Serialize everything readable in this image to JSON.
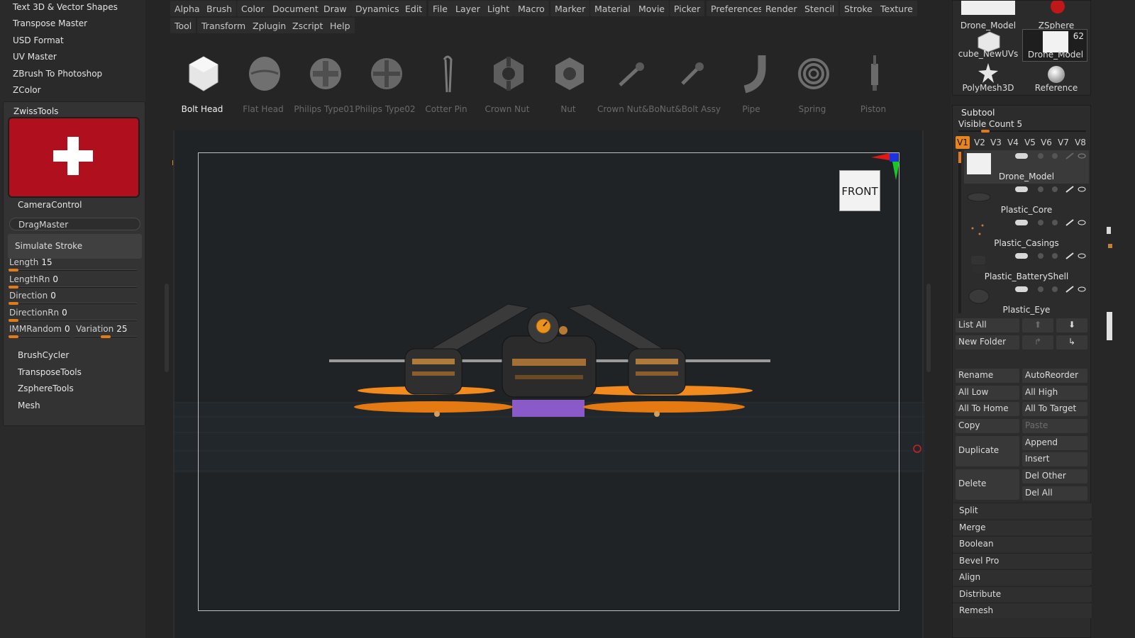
{
  "left_panel": {
    "plugins_top": [
      "Text 3D & Vector Shapes",
      "Transpose Master",
      "USD Format",
      "UV Master",
      "ZBrush To Photoshop",
      "ZColor"
    ],
    "zwiss": {
      "title": "ZwissTools",
      "logo": "swiss-cross-logo",
      "camera_control": "CameraControl",
      "drag_master": "DragMaster",
      "simulate_stroke": "Simulate Stroke",
      "sliders": [
        {
          "label": "Length",
          "value": "15"
        },
        {
          "label": "LengthRn",
          "value": "0"
        },
        {
          "label": "Direction",
          "value": "0"
        },
        {
          "label": "DirectionRn",
          "value": "0"
        }
      ],
      "imm_random": {
        "label": "IMMRandom",
        "value": "0"
      },
      "variation": {
        "label": "Variation",
        "value": "25"
      },
      "bottom_items": [
        "BrushCycler",
        "TransposeTools",
        "ZsphereTools",
        "Mesh"
      ]
    }
  },
  "menus": {
    "row1": [
      "Alpha",
      "Brush",
      "Color",
      "Document",
      "Draw",
      "Dynamics",
      "Edit",
      "File",
      "Layer",
      "Light",
      "Macro",
      "Marker",
      "Material",
      "Movie",
      "Picker",
      "Preferences",
      "Render",
      "Stencil",
      "Stroke",
      "Texture"
    ],
    "row2": [
      "Tool",
      "Transform",
      "Zplugin",
      "Zscript",
      "Help"
    ]
  },
  "palette": {
    "tools": [
      {
        "label": "Bolt Head",
        "icon": "bolt-head-icon",
        "active": true
      },
      {
        "label": "Flat Head",
        "icon": "flat-head-icon"
      },
      {
        "label": "Philips Type01",
        "icon": "philips-type01-icon"
      },
      {
        "label": "Philips Type02",
        "icon": "philips-type02-icon"
      },
      {
        "label": "Cotter Pin",
        "icon": "cotter-pin-icon"
      },
      {
        "label": "Crown Nut",
        "icon": "crown-nut-icon"
      },
      {
        "label": "Nut",
        "icon": "nut-icon"
      },
      {
        "label": "Crown Nut&Bol",
        "icon": "crown-nut-bolt-icon"
      },
      {
        "label": "Nut&Bolt Assy",
        "icon": "nut-bolt-assy-icon"
      },
      {
        "label": "Pipe",
        "icon": "pipe-icon"
      },
      {
        "label": "Spring",
        "icon": "spring-icon"
      },
      {
        "label": "Piston",
        "icon": "piston-icon"
      }
    ],
    "progress": 0.044
  },
  "viewport": {
    "view_label": "FRONT",
    "model": "drone-model-render",
    "colors": {
      "background": "#1f2326",
      "accent": "#e8851d",
      "propeller": "#f28a1e",
      "base": "#8a5ac8"
    }
  },
  "right_panel": {
    "thumbnails": [
      {
        "label": "Drone_Model",
        "icon": "drone-model-thumb-icon"
      },
      {
        "label": "ZSphere",
        "icon": "zsphere-icon"
      },
      {
        "label": "cube_NewUVs",
        "icon": "cube-icon"
      },
      {
        "label": "Drone_Model",
        "icon": "drone-model-thumb-icon",
        "badge": "62",
        "selected": true
      },
      {
        "label": "PolyMesh3D",
        "icon": "polymesh-star-icon"
      },
      {
        "label": "Reference",
        "icon": "reference-sphere-icon"
      }
    ],
    "subtool": {
      "title": "Subtool",
      "visible_count_label": "Visible Count",
      "visible_count": "5",
      "versions": [
        "V1",
        "V2",
        "V3",
        "V4",
        "V5",
        "V6",
        "V7",
        "V8"
      ],
      "active_version": "V1",
      "items": [
        {
          "name": "Drone_Model",
          "selected": true
        },
        {
          "name": "Plastic_Core"
        },
        {
          "name": "Plastic_Casings"
        },
        {
          "name": "Plastic_BatteryShell"
        },
        {
          "name": "Plastic_Eye"
        }
      ],
      "list_all": "List All",
      "new_folder": "New Folder",
      "buttons": {
        "rename": "Rename",
        "auto_reorder": "AutoReorder",
        "all_low": "All Low",
        "all_high": "All High",
        "all_to_home": "All To Home",
        "all_to_target": "All To Target",
        "copy": "Copy",
        "paste": "Paste",
        "duplicate": "Duplicate",
        "append": "Append",
        "insert": "Insert",
        "delete": "Delete",
        "del_other": "Del Other",
        "del_all": "Del All"
      },
      "sections": [
        "Split",
        "Merge",
        "Boolean",
        "Bevel Pro",
        "Align",
        "Distribute",
        "Remesh"
      ]
    }
  }
}
